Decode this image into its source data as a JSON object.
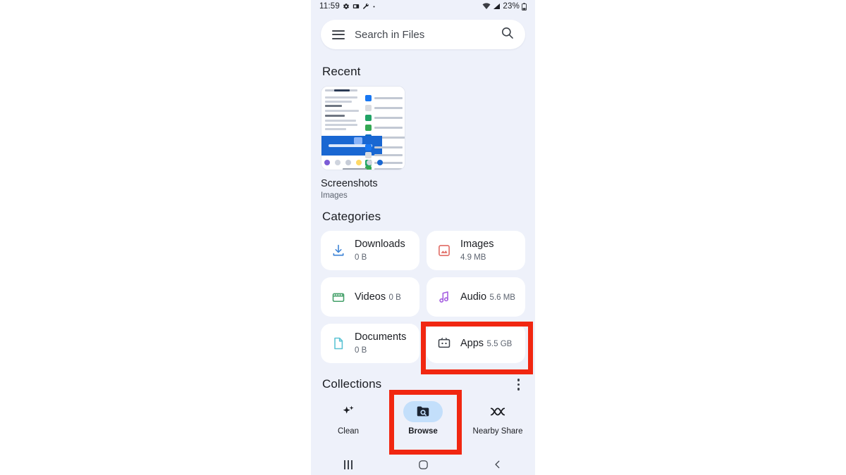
{
  "statusbar": {
    "time": "11:59",
    "icons_left": [
      "gear-icon",
      "screenshot-icon",
      "wrench-icon",
      "dot-icon"
    ],
    "icons_right": [
      "wifi-icon",
      "signal-icon"
    ],
    "battery": "23%"
  },
  "search": {
    "menu_icon": "hamburger-menu-icon",
    "placeholder": "Search in Files",
    "search_icon": "search-icon"
  },
  "recent": {
    "title": "Recent",
    "item": {
      "name": "Screenshots",
      "type": "Images"
    }
  },
  "categories": {
    "title": "Categories",
    "items": [
      {
        "label": "Downloads",
        "size": "0 B",
        "icon": "download-icon",
        "color": "#3b82d6"
      },
      {
        "label": "Images",
        "size": "4.9 MB",
        "icon": "image-icon",
        "color": "#e06a63"
      },
      {
        "label": "Videos",
        "size": "0 B",
        "icon": "video-icon",
        "color": "#45a06a"
      },
      {
        "label": "Audio",
        "size": "5.6 MB",
        "icon": "audio-icon",
        "color": "#a45de0"
      },
      {
        "label": "Documents",
        "size": "0 B",
        "icon": "document-icon",
        "color": "#5bc3d4"
      },
      {
        "label": "Apps",
        "size": "5.5 GB",
        "icon": "apps-icon",
        "color": "#3c4149"
      }
    ]
  },
  "collections": {
    "title": "Collections",
    "menu_icon": "more-options-icon"
  },
  "bottomnav": {
    "items": [
      {
        "label": "Clean",
        "icon": "sparkle-icon",
        "active": false
      },
      {
        "label": "Browse",
        "icon": "folder-search-icon",
        "active": true
      },
      {
        "label": "Nearby Share",
        "icon": "nearby-share-icon",
        "active": false
      }
    ]
  },
  "sysnav": {
    "items": [
      "recents-icon",
      "home-icon",
      "back-icon"
    ]
  },
  "annotations": {
    "highlight_color": "#f12711",
    "boxes": [
      "apps-category-card",
      "browse-nav-item"
    ]
  }
}
